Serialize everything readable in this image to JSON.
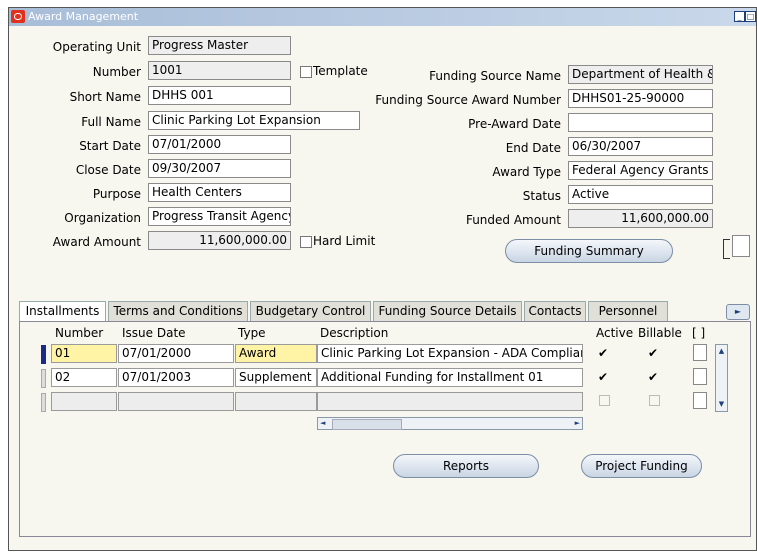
{
  "window": {
    "title": "Award Management"
  },
  "form": {
    "operating_unit_label": "Operating Unit",
    "operating_unit": "Progress Master",
    "number_label": "Number",
    "number": "1001",
    "template_label": "Template",
    "short_name_label": "Short Name",
    "short_name": "DHHS 001",
    "full_name_label": "Full Name",
    "full_name": "Clinic Parking Lot Expansion",
    "start_date_label": "Start Date",
    "start_date": "07/01/2000",
    "close_date_label": "Close Date",
    "close_date": "09/30/2007",
    "purpose_label": "Purpose",
    "purpose": "Health Centers",
    "organization_label": "Organization",
    "organization": "Progress Transit Agency",
    "award_amount_label": "Award Amount",
    "award_amount": "11,600,000.00",
    "hard_limit_label": "Hard Limit",
    "funding_source_name_label": "Funding Source Name",
    "funding_source_name": "Department of Health &",
    "funding_source_award_number_label": "Funding Source Award Number",
    "funding_source_award_number": "DHHS01-25-90000",
    "pre_award_date_label": "Pre-Award Date",
    "pre_award_date": "",
    "end_date_label": "End Date",
    "end_date": "06/30/2007",
    "award_type_label": "Award Type",
    "award_type": "Federal Agency Grants",
    "status_label": "Status",
    "status": "Active",
    "funded_amount_label": "Funded Amount",
    "funded_amount": "11,600,000.00",
    "funding_summary_button": "Funding Summary"
  },
  "tabs": [
    "Installments",
    "Terms and Conditions",
    "Budgetary Control",
    "Funding Source Details",
    "Contacts",
    "Personnel"
  ],
  "grid": {
    "headers": {
      "number": "Number",
      "issue_date": "Issue Date",
      "type": "Type",
      "description": "Description",
      "active": "Active",
      "billable": "Billable",
      "extra": "[ ]"
    },
    "rows": [
      {
        "number": "01",
        "issue_date": "07/01/2000",
        "type": "Award",
        "description": "Clinic Parking Lot Expansion - ADA Complian",
        "active": "✔",
        "billable": "✔"
      },
      {
        "number": "02",
        "issue_date": "07/01/2003",
        "type": "Supplement",
        "description": "Additional Funding for Installment 01",
        "active": "✔",
        "billable": "✔"
      }
    ]
  },
  "buttons": {
    "reports": "Reports",
    "project_funding": "Project Funding"
  }
}
